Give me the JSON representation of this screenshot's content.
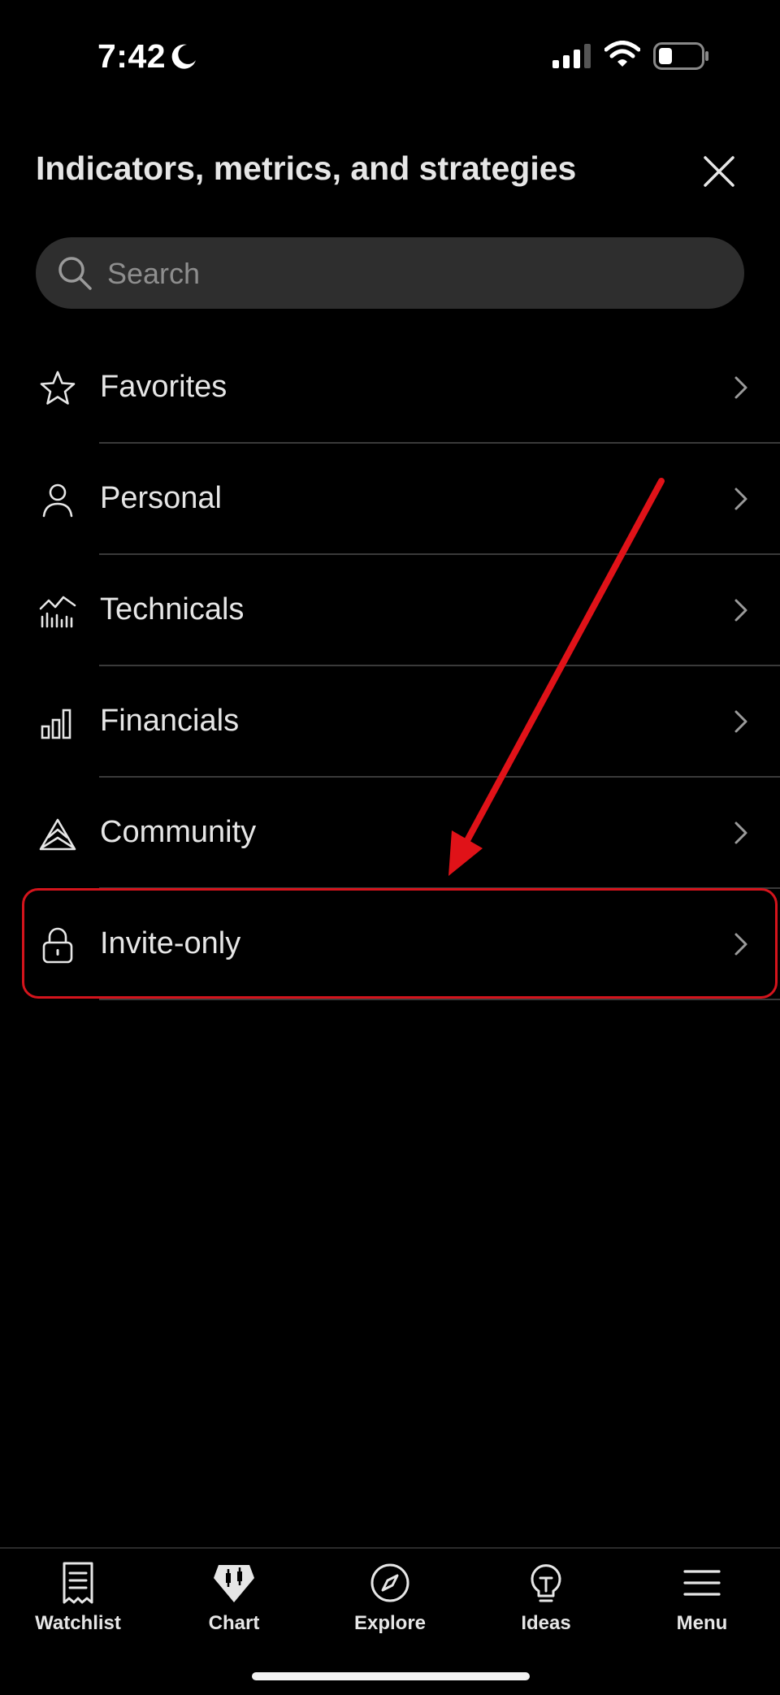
{
  "status_bar": {
    "time": "7:42"
  },
  "header": {
    "title": "Indicators, metrics, and strategies"
  },
  "search": {
    "placeholder": "Search"
  },
  "categories": [
    {
      "label": "Favorites",
      "icon": "star-icon"
    },
    {
      "label": "Personal",
      "icon": "person-icon"
    },
    {
      "label": "Technicals",
      "icon": "technicals-chart-icon"
    },
    {
      "label": "Financials",
      "icon": "bar-chart-icon"
    },
    {
      "label": "Community",
      "icon": "community-mountain-icon"
    },
    {
      "label": "Invite-only",
      "icon": "lock-icon"
    }
  ],
  "annotation": {
    "highlight_color": "#d4141c"
  },
  "tabbar": {
    "tabs": [
      {
        "label": "Watchlist",
        "icon": "watchlist-icon"
      },
      {
        "label": "Chart",
        "icon": "chart-icon"
      },
      {
        "label": "Explore",
        "icon": "compass-icon"
      },
      {
        "label": "Ideas",
        "icon": "lightbulb-icon"
      },
      {
        "label": "Menu",
        "icon": "hamburger-menu-icon"
      }
    ]
  }
}
